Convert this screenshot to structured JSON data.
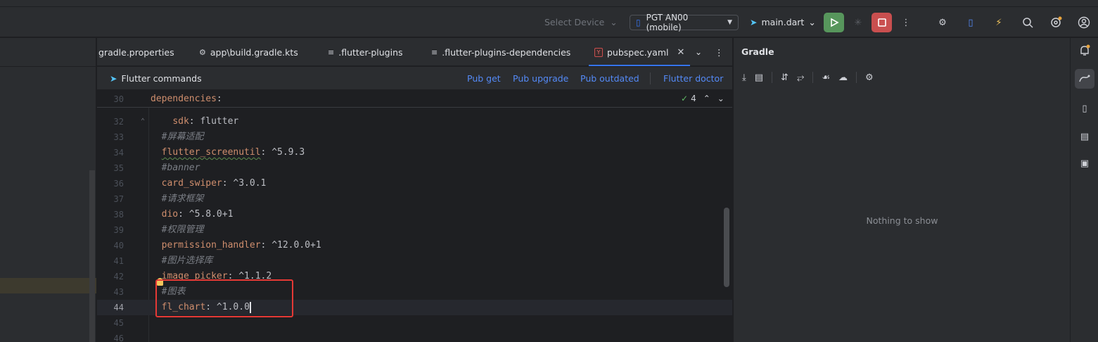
{
  "toolbar": {
    "select_device": "Select Device",
    "device": "PGT AN00 (mobile)",
    "run_config": "main.dart"
  },
  "tabs": [
    {
      "label": "gradle.properties"
    },
    {
      "label": "app\\build.gradle.kts"
    },
    {
      "label": ".flutter-plugins"
    },
    {
      "label": ".flutter-plugins-dependencies"
    },
    {
      "label": "pubspec.yaml",
      "active": true
    }
  ],
  "flutter_commands": {
    "title": "Flutter commands",
    "pub_get": "Pub get",
    "pub_upgrade": "Pub upgrade",
    "pub_outdated": "Pub outdated",
    "flutter_doctor": "Flutter doctor"
  },
  "inspection": {
    "count": "4"
  },
  "sticky": {
    "ln": "30",
    "key": "dependencies",
    "colon": ":"
  },
  "lines": [
    {
      "ln": "32",
      "key": "sdk",
      "val": " flutter",
      "indent": "    "
    },
    {
      "ln": "33",
      "comment": "#屏幕适配",
      "indent": "  "
    },
    {
      "ln": "34",
      "key": "flutter_screenutil",
      "val": " ^5.9.3",
      "indent": "  "
    },
    {
      "ln": "35",
      "comment": "#banner",
      "indent": "  "
    },
    {
      "ln": "36",
      "key": "card_swiper",
      "val": " ^3.0.1",
      "indent": "  "
    },
    {
      "ln": "37",
      "comment": "#请求框架",
      "indent": "  "
    },
    {
      "ln": "38",
      "key": "dio",
      "val": " ^5.8.0+1",
      "indent": "  "
    },
    {
      "ln": "39",
      "comment": "#权限管理",
      "indent": "  "
    },
    {
      "ln": "40",
      "key": "permission_handler",
      "val": " ^12.0.0+1",
      "indent": "  "
    },
    {
      "ln": "41",
      "comment": "#图片选择库",
      "indent": "  "
    },
    {
      "ln": "42",
      "key": "image_picker",
      "val": " ^1.1.2",
      "indent": "  "
    },
    {
      "ln": "43",
      "comment": "#图表",
      "indent": "  "
    },
    {
      "ln": "44",
      "key": "fl_chart",
      "val": " ^1.0.0",
      "indent": "  "
    },
    {
      "ln": "45"
    },
    {
      "ln": "46"
    }
  ],
  "gradle": {
    "title": "Gradle",
    "empty": "Nothing to show"
  }
}
